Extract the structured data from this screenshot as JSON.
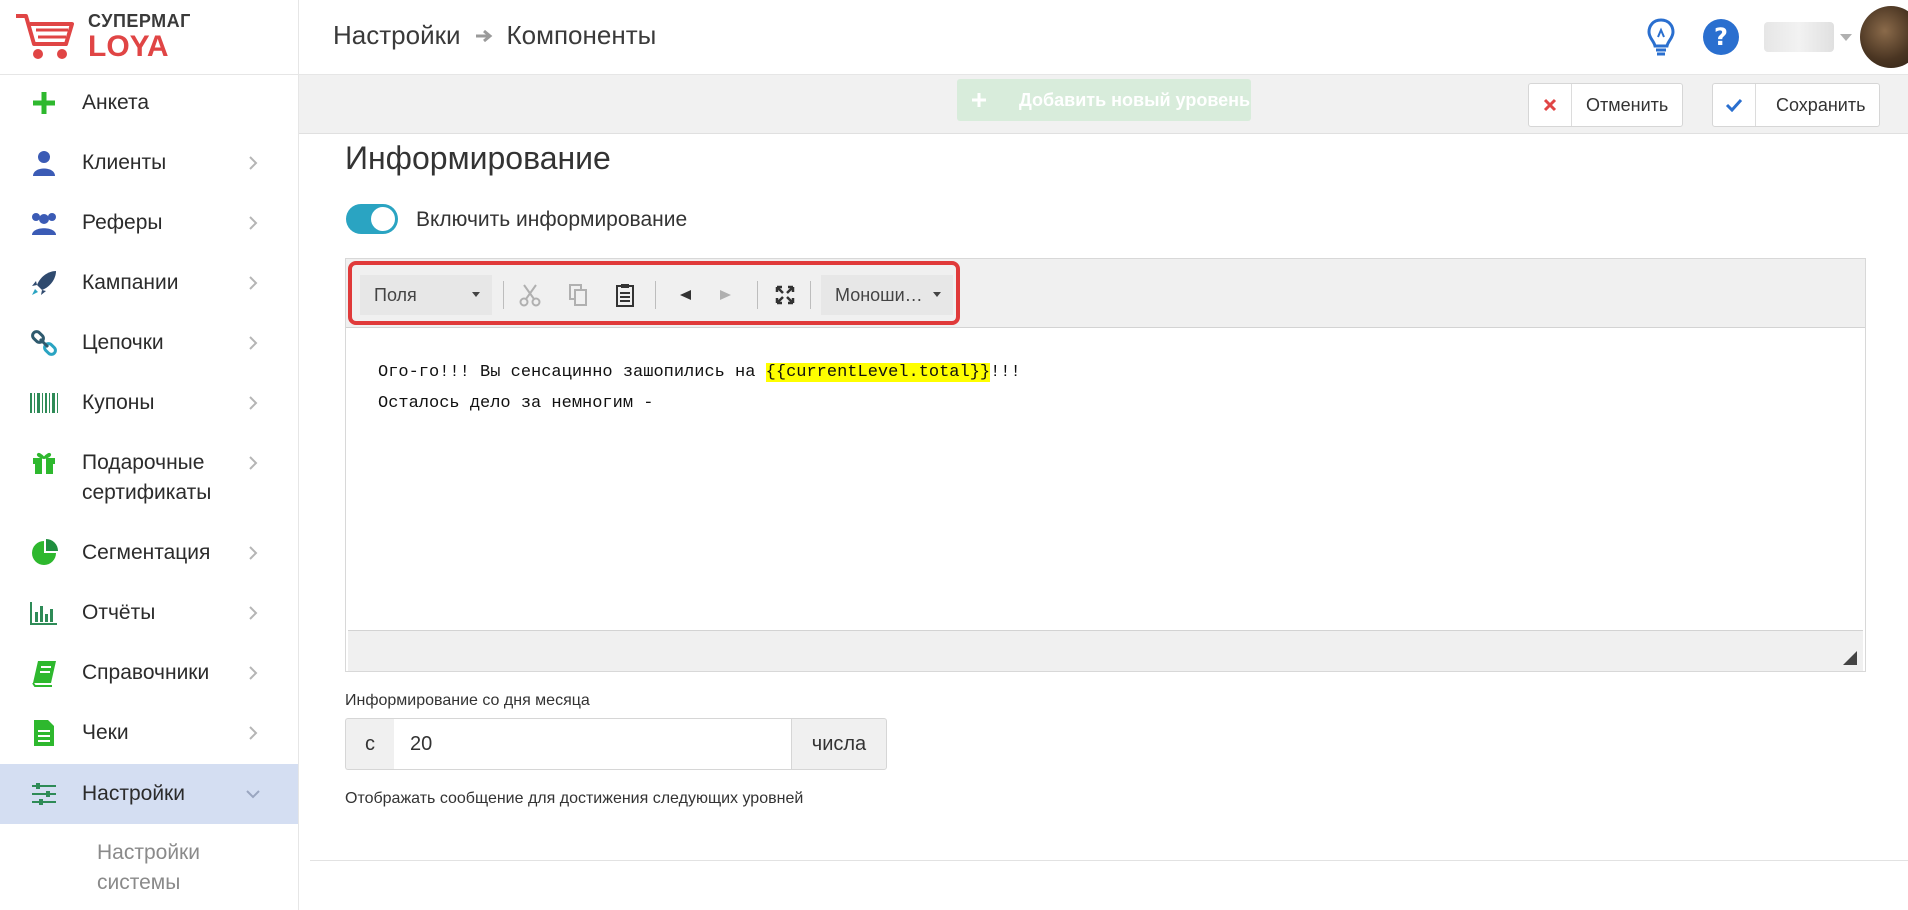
{
  "app": {
    "brand": "СУПЕРМАГ",
    "product": "LOYA",
    "colors": {
      "accent": "#e04545",
      "nav_active_bg": "#d4def2",
      "toggle_on": "#2aa4c2",
      "success": "#2eb82e"
    }
  },
  "sidebar": {
    "items": [
      {
        "label": "Анкета",
        "icon": "plus-icon"
      },
      {
        "label": "Клиенты",
        "icon": "user-icon"
      },
      {
        "label": "Реферы",
        "icon": "users-icon"
      },
      {
        "label": "Кампании",
        "icon": "rocket-icon"
      },
      {
        "label": "Цепочки",
        "icon": "chain-icon"
      },
      {
        "label": "Купоны",
        "icon": "barcode-icon"
      },
      {
        "label": "Подарочные",
        "label2": "сертификаты",
        "icon": "gift-icon"
      },
      {
        "label": "Сегментация",
        "icon": "pie-chart-icon"
      },
      {
        "label": "Отчёты",
        "icon": "bar-chart-icon"
      },
      {
        "label": "Справочники",
        "icon": "book-icon"
      },
      {
        "label": "Чеки",
        "icon": "receipt-icon"
      },
      {
        "label": "Настройки",
        "icon": "sliders-icon",
        "active": true
      }
    ],
    "subitem": {
      "line1": "Настройки",
      "line2": "системы"
    }
  },
  "header": {
    "crumb1": "Настройки",
    "crumb2": "Компоненты",
    "icons": [
      "lightbulb-icon",
      "help-icon"
    ]
  },
  "actionbar": {
    "add_level": "Добавить новый уровень",
    "cancel": "Отменить",
    "save": "Сохранить"
  },
  "section": {
    "title": "Информирование",
    "toggle_label": "Включить информирование",
    "toggle_on": true
  },
  "editor": {
    "fields_select": "Поля",
    "font_select": "Моноши…",
    "line1_pre": "Ого-го!!! Вы сенсацинно зашопились на ",
    "line1_var": "{{currentLevel.total}}",
    "line1_post": "!!!",
    "line2": "Осталось дело за немногим -"
  },
  "form": {
    "day_label": "Информирование со дня месяца",
    "prefix": "с",
    "day_value": "20",
    "suffix": "числа",
    "help": "Отображать сообщение для достижения следующих уровней"
  }
}
